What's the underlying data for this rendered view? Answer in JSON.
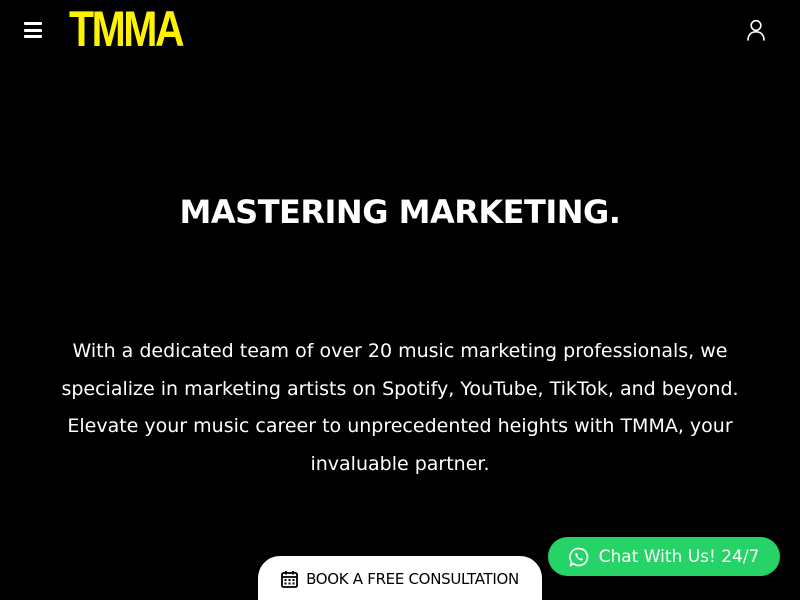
{
  "header": {
    "logo_text": "TMMA",
    "menu_icon": "hamburger-menu-icon",
    "account_icon": "user-icon"
  },
  "hero": {
    "headline": "MASTERING MARKETING.",
    "description": "With a dedicated team of over 20 music marketing professionals, we specialize in marketing artists on Spotify, YouTube, TikTok, and beyond. Elevate your music career to unprecedented heights with TMMA, your invaluable partner."
  },
  "cta": {
    "book_label": "BOOK A FREE CONSULTATION",
    "book_icon": "calendar-icon"
  },
  "chat": {
    "label": "Chat With Us! 24/7",
    "icon": "whatsapp-icon"
  },
  "colors": {
    "background": "#000000",
    "logo": "#fff200",
    "text": "#ffffff",
    "chat_button": "#25d366",
    "book_button": "#ffffff"
  }
}
